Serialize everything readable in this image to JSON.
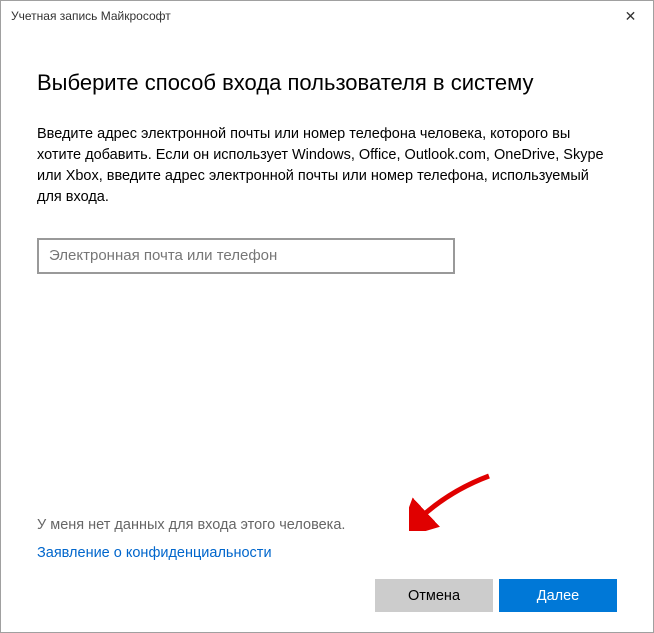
{
  "window": {
    "title": "Учетная запись Майкрософт"
  },
  "content": {
    "heading": "Выберите способ входа пользователя в систему",
    "description": "Введите адрес электронной почты или номер телефона человека, которого вы хотите добавить. Если он использует Windows, Office, Outlook.com, OneDrive, Skype или Xbox, введите адрес электронной почты или номер телефона, используемый для входа.",
    "input_placeholder": "Электронная почта или телефон",
    "no_signin_link": "У меня нет данных для входа этого человека.",
    "privacy_link": "Заявление о конфиденциальности"
  },
  "buttons": {
    "cancel": "Отмена",
    "next": "Далее"
  }
}
